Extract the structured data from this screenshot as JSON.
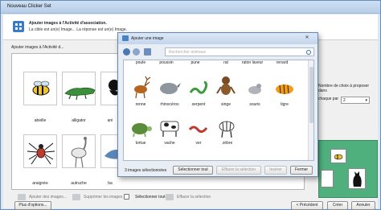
{
  "window": {
    "title": "Nouveau Clicker Set"
  },
  "header": {
    "title": "Ajouter images à l'Activité d'association.",
    "subtitle": "La cible est un(e) Image... La réponse est un(e) Image."
  },
  "main": {
    "add_images_label": "Ajouter images à l'Activité d...",
    "tiles": [
      {
        "label": "abeille"
      },
      {
        "label": "alligator"
      },
      {
        "label": "ani"
      },
      {
        "label": "araignée"
      },
      {
        "label": "autruche"
      },
      {
        "label": "ba"
      }
    ],
    "toolbar": {
      "add": "Ajouter des images...",
      "remove": "Supprimer les images",
      "select_all": "Sélectionner tout",
      "clear": "Effacer la sélection"
    }
  },
  "right_panel": {
    "label": "Nombre de choix à proposer dans",
    "sub": "chaque par",
    "select_value": "2"
  },
  "footer": {
    "more_options": "Plus d'options...",
    "previous": "< Précédent",
    "create": "Créer",
    "cancel": "Annuler"
  },
  "dialog": {
    "title": "Ajouter une image",
    "close_symbol": "✕",
    "search_placeholder": "Rechercher animaux",
    "top_row_labels": [
      "poule",
      "poussin",
      "pune",
      "rat",
      "raton laveur",
      "renard"
    ],
    "rows": [
      [
        "renne",
        "rhinocéros",
        "serpent",
        "singe",
        "souris",
        "tigre"
      ],
      [
        "tortue",
        "vache",
        "ver",
        "zèbre"
      ]
    ],
    "count_text": "3 images sélectionnées",
    "buttons": {
      "select_all": "Sélectionner tout",
      "clear": "Effacer la sélection",
      "insert": "Insérer",
      "close": "Fermer"
    }
  },
  "colors": {
    "accent": "#3a7bc8",
    "preview_bg": "#4fb07d"
  }
}
